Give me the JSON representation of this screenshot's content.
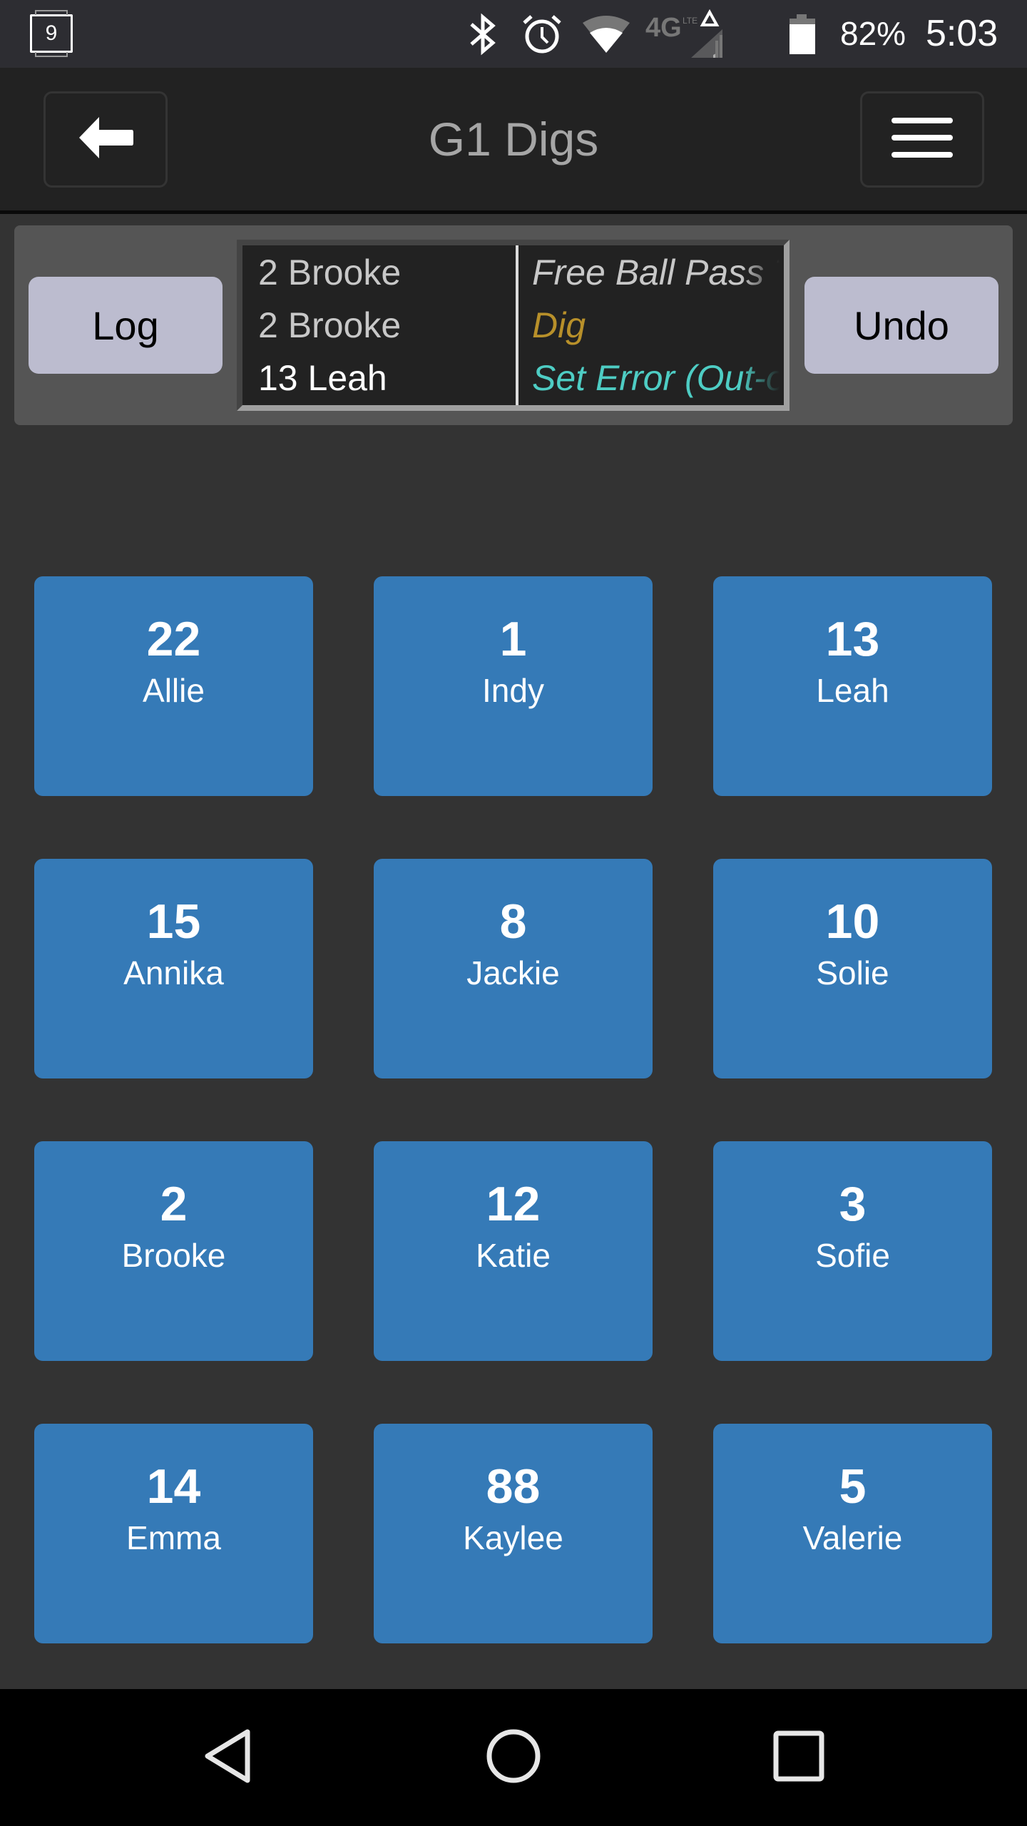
{
  "status_bar": {
    "notification_count": "9",
    "icons": [
      "bluetooth-icon",
      "alarm-icon",
      "wifi-icon",
      "4g-lte-icon",
      "cell-signal-icon",
      "battery-icon"
    ],
    "network_label": "4G LTE",
    "battery_percent": "82%",
    "battery_level": 0.82,
    "time": "5:03"
  },
  "header": {
    "title": "G1 Digs",
    "back_icon": "arrow-left-icon",
    "menu_icon": "hamburger-menu-icon"
  },
  "log_panel": {
    "log_button": "Log",
    "undo_button": "Undo",
    "entries": [
      {
        "player": "2 Brooke",
        "action": "Free Ball Pass To",
        "player_color": "#c8c8c8",
        "action_color": "#c8c8c8"
      },
      {
        "player": "2 Brooke",
        "action": "Dig",
        "player_color": "#c8c8c8",
        "action_color": "#b8902a"
      },
      {
        "player": "13 Leah",
        "action": "Set Error (Out-of",
        "player_color": "#ffffff",
        "action_color": "#4ecdc4"
      }
    ]
  },
  "players": [
    {
      "number": "22",
      "name": "Allie"
    },
    {
      "number": "1",
      "name": "Indy"
    },
    {
      "number": "13",
      "name": "Leah"
    },
    {
      "number": "15",
      "name": "Annika"
    },
    {
      "number": "8",
      "name": "Jackie"
    },
    {
      "number": "10",
      "name": "Solie"
    },
    {
      "number": "2",
      "name": "Brooke"
    },
    {
      "number": "12",
      "name": "Katie"
    },
    {
      "number": "3",
      "name": "Sofie"
    },
    {
      "number": "14",
      "name": "Emma"
    },
    {
      "number": "88",
      "name": "Kaylee"
    },
    {
      "number": "5",
      "name": "Valerie"
    }
  ],
  "colors": {
    "tile": "#357ab7",
    "action_button": "#bcbccf",
    "panel": "#555555",
    "background": "#333333"
  },
  "nav_bar": {
    "buttons": [
      "back-icon",
      "home-icon",
      "recents-icon"
    ]
  }
}
